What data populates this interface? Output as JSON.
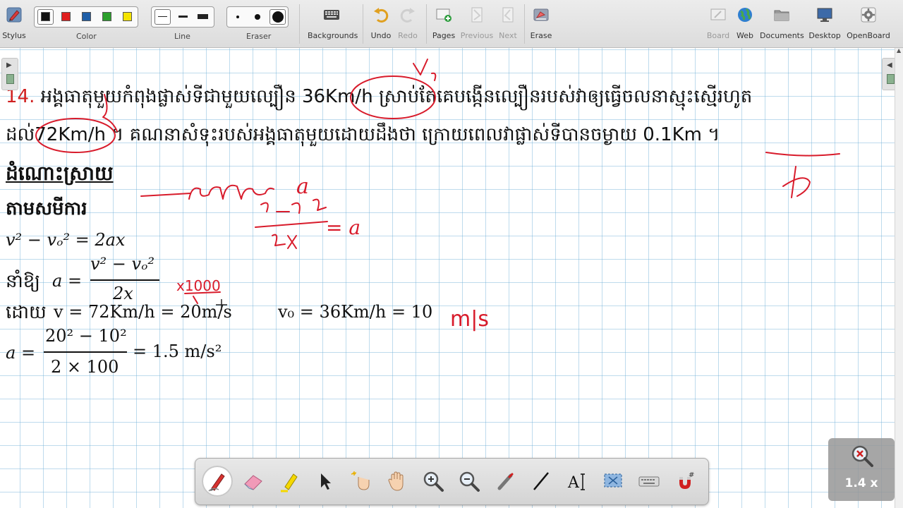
{
  "toolbar": {
    "left_items": [
      {
        "label": "Stylus",
        "icon": "stylus-icon"
      }
    ],
    "color": {
      "label": "Color",
      "swatches": [
        "#111111",
        "#e02020",
        "#1f5fa8",
        "#2ca02c",
        "#f5e400"
      ],
      "selected_index": 0
    },
    "line": {
      "label": "Line",
      "selected_index": 0
    },
    "eraser": {
      "label": "Eraser",
      "selected_index": 2
    },
    "items": [
      {
        "label": "Backgrounds",
        "icon": "keyboard-grid-icon",
        "enabled": true
      },
      {
        "label": "Undo",
        "icon": "undo-icon",
        "enabled": true
      },
      {
        "label": "Redo",
        "icon": "redo-icon",
        "enabled": false
      },
      {
        "label": "Pages",
        "icon": "add-page-icon",
        "enabled": true
      },
      {
        "label": "Previous",
        "icon": "previous-page-icon",
        "enabled": false
      },
      {
        "label": "Next",
        "icon": "next-page-icon",
        "enabled": false
      },
      {
        "label": "Erase",
        "icon": "erase-board-icon",
        "enabled": true
      }
    ],
    "right_items": [
      {
        "label": "Board",
        "icon": "board-icon",
        "enabled": false
      },
      {
        "label": "Web",
        "icon": "globe-icon",
        "enabled": true
      },
      {
        "label": "Documents",
        "icon": "folder-icon",
        "enabled": true
      },
      {
        "label": "Desktop",
        "icon": "monitor-icon",
        "enabled": true
      },
      {
        "label": "OpenBoard",
        "icon": "gear-icon",
        "enabled": true
      }
    ]
  },
  "content": {
    "problem_number": "14.",
    "line1_text": "អង្គធាតុមួយកំពុងផ្លាស់ទីជាមួយល្បឿន",
    "speed1": "36Km/h",
    "line1_rest": "ស្រាប់តែគេបង្កើនល្បឿនរបស់វាឲ្យធ្វើចលនាស្មុះស្មើរហូត",
    "line2_pre": "ដល់",
    "speed2": "72Km/h",
    "line2_text": "។ គណនាសំទុះរបស់អង្គធាតុមួយដោយដឹងថា ក្រោយពេលវាផ្លាស់ទីបានចម្ងាយ",
    "distance": "0.1Km",
    "line2_end": "។",
    "heading_solution": "ដំណោះស្រាយ",
    "heading_formula": "តាមសមីការ",
    "eq1": "v² − vₒ² = 2ax",
    "eq2_prefix": "នាំឱ្យ",
    "eq2_lhs": "a =",
    "eq2_num": "v² − vₒ²",
    "eq2_den": "2x",
    "eq3_prefix": "ដោយ",
    "eq3_v": "v =  72Km/h = 20m/s",
    "eq3_v0": "v₀ = 36Km/h = 10",
    "eq4_lhs": "a =",
    "eq4_num": "20² − 10²",
    "eq4_den": "2 × 100",
    "eq4_rhs": "= 1.5 m/s²"
  },
  "handwriting": {
    "a_label": "a",
    "formula_rhs": "= a",
    "times_1000": "x1000",
    "unit_tail": "m|s"
  },
  "zoom": {
    "label": "1.4 x",
    "icon": "zoom-reset-icon"
  },
  "bottom_tools": [
    {
      "name": "pen-tool",
      "icon": "pen-icon",
      "active": true
    },
    {
      "name": "eraser-tool",
      "icon": "eraser-icon",
      "active": false
    },
    {
      "name": "highlighter-tool",
      "icon": "highlighter-icon",
      "active": false
    },
    {
      "name": "select-tool",
      "icon": "cursor-arrow-icon",
      "active": false
    },
    {
      "name": "interact-tool",
      "icon": "magic-hand-icon",
      "active": false
    },
    {
      "name": "hand-tool",
      "icon": "hand-icon",
      "active": false
    },
    {
      "name": "zoom-in-tool",
      "icon": "zoom-in-icon",
      "active": false
    },
    {
      "name": "zoom-out-tool",
      "icon": "zoom-out-icon",
      "active": false
    },
    {
      "name": "laser-pointer-tool",
      "icon": "laser-pointer-icon",
      "active": false
    },
    {
      "name": "line-tool",
      "icon": "line-icon",
      "active": false
    },
    {
      "name": "text-tool",
      "icon": "text-icon",
      "active": false
    },
    {
      "name": "capture-tool",
      "icon": "capture-icon",
      "active": false
    },
    {
      "name": "keyboard-tool",
      "icon": "keyboard-icon",
      "active": false
    },
    {
      "name": "magnet-tool",
      "icon": "magnet-icon",
      "active": false
    }
  ]
}
